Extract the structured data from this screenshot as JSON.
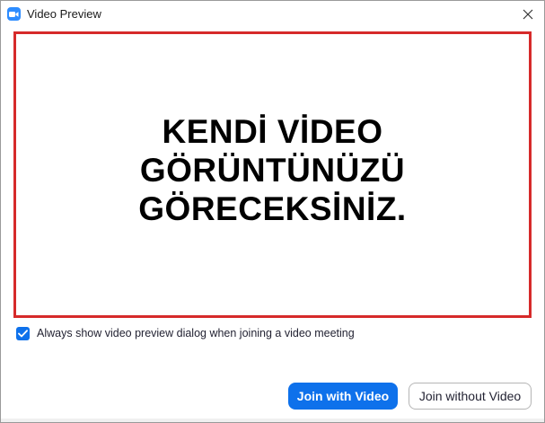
{
  "window": {
    "title": "Video Preview"
  },
  "icons": {
    "app": "zoom-camera-icon",
    "close": "close-icon",
    "check": "checkmark-icon"
  },
  "preview": {
    "message": "KENDİ VİDEO\nGÖRÜNTÜNÜZÜ\nGÖRECEKSİNİZ."
  },
  "options": {
    "always_show_label": "Always show video preview dialog when joining a video meeting",
    "always_show_checked": true
  },
  "buttons": {
    "join_with_video": "Join with Video",
    "join_without_video": "Join without Video"
  },
  "colors": {
    "accent": "#0e71eb",
    "preview_border": "#d62a2a"
  }
}
